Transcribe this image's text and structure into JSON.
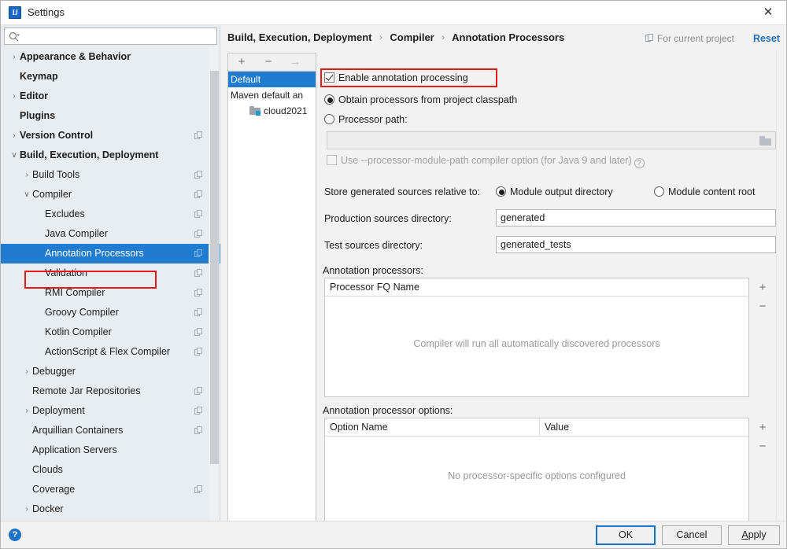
{
  "window": {
    "title": "Settings",
    "app_icon": "intellij-idea-icon",
    "close_icon": "close-icon"
  },
  "search": {
    "icon": "search-icon",
    "value": "",
    "placeholder": ""
  },
  "sidebar": {
    "items": [
      {
        "label": "Appearance & Behavior",
        "indent": 0,
        "arrow": "›",
        "bold": true,
        "config_icon": false,
        "selected": false
      },
      {
        "label": "Keymap",
        "indent": 0,
        "arrow": "",
        "bold": true,
        "config_icon": false,
        "selected": false
      },
      {
        "label": "Editor",
        "indent": 0,
        "arrow": "›",
        "bold": true,
        "config_icon": false,
        "selected": false
      },
      {
        "label": "Plugins",
        "indent": 0,
        "arrow": "",
        "bold": true,
        "config_icon": false,
        "selected": false
      },
      {
        "label": "Version Control",
        "indent": 0,
        "arrow": "›",
        "bold": true,
        "config_icon": true,
        "selected": false
      },
      {
        "label": "Build, Execution, Deployment",
        "indent": 0,
        "arrow": "∨",
        "bold": true,
        "config_icon": false,
        "selected": false
      },
      {
        "label": "Build Tools",
        "indent": 1,
        "arrow": "›",
        "bold": false,
        "config_icon": true,
        "selected": false
      },
      {
        "label": "Compiler",
        "indent": 1,
        "arrow": "∨",
        "bold": false,
        "config_icon": true,
        "selected": false
      },
      {
        "label": "Excludes",
        "indent": 2,
        "arrow": "",
        "bold": false,
        "config_icon": true,
        "selected": false
      },
      {
        "label": "Java Compiler",
        "indent": 2,
        "arrow": "",
        "bold": false,
        "config_icon": true,
        "selected": false
      },
      {
        "label": "Annotation Processors",
        "indent": 2,
        "arrow": "",
        "bold": false,
        "config_icon": true,
        "selected": true
      },
      {
        "label": "Validation",
        "indent": 2,
        "arrow": "",
        "bold": false,
        "config_icon": true,
        "selected": false
      },
      {
        "label": "RMI Compiler",
        "indent": 2,
        "arrow": "",
        "bold": false,
        "config_icon": true,
        "selected": false
      },
      {
        "label": "Groovy Compiler",
        "indent": 2,
        "arrow": "",
        "bold": false,
        "config_icon": true,
        "selected": false
      },
      {
        "label": "Kotlin Compiler",
        "indent": 2,
        "arrow": "",
        "bold": false,
        "config_icon": true,
        "selected": false
      },
      {
        "label": "ActionScript & Flex Compiler",
        "indent": 2,
        "arrow": "",
        "bold": false,
        "config_icon": true,
        "selected": false
      },
      {
        "label": "Debugger",
        "indent": 1,
        "arrow": "›",
        "bold": false,
        "config_icon": false,
        "selected": false
      },
      {
        "label": "Remote Jar Repositories",
        "indent": 1,
        "arrow": "",
        "bold": false,
        "config_icon": true,
        "selected": false
      },
      {
        "label": "Deployment",
        "indent": 1,
        "arrow": "›",
        "bold": false,
        "config_icon": true,
        "selected": false
      },
      {
        "label": "Arquillian Containers",
        "indent": 1,
        "arrow": "",
        "bold": false,
        "config_icon": true,
        "selected": false
      },
      {
        "label": "Application Servers",
        "indent": 1,
        "arrow": "",
        "bold": false,
        "config_icon": false,
        "selected": false
      },
      {
        "label": "Clouds",
        "indent": 1,
        "arrow": "",
        "bold": false,
        "config_icon": false,
        "selected": false
      },
      {
        "label": "Coverage",
        "indent": 1,
        "arrow": "",
        "bold": false,
        "config_icon": true,
        "selected": false
      },
      {
        "label": "Docker",
        "indent": 1,
        "arrow": "›",
        "bold": false,
        "config_icon": false,
        "selected": false
      }
    ]
  },
  "header": {
    "breadcrumb": [
      "Build, Execution, Deployment",
      "Compiler",
      "Annotation Processors"
    ],
    "separator": "›",
    "for_current_project": "For current project",
    "for_current_project_icon": "copy-config-icon",
    "reset_label": "Reset"
  },
  "profiles": {
    "toolbar": {
      "add_label": "+",
      "remove_label": "−",
      "move_label": "→"
    },
    "items": [
      {
        "label": "Default",
        "selected": true,
        "icon": null
      },
      {
        "label": "Maven default an",
        "selected": false,
        "icon": null
      },
      {
        "label": "cloud2021",
        "selected": false,
        "icon": "module-folder-icon"
      }
    ]
  },
  "main": {
    "enable_annotation_processing": {
      "label": "Enable annotation processing",
      "checked": true,
      "highlighted": true
    },
    "processor_source": {
      "option_classpath": "Obtain processors from project classpath",
      "option_path": "Processor path:",
      "selected": "classpath",
      "path_value": "",
      "folder_icon": "folder-browse-icon"
    },
    "module_path_option": {
      "label": "Use --processor-module-path compiler option (for Java 9 and later)",
      "checked": false,
      "disabled": true,
      "help_icon": "?"
    },
    "store_generated": {
      "label": "Store generated sources relative to:",
      "option_output": "Module output directory",
      "option_content": "Module content root",
      "selected": "output"
    },
    "production_sources": {
      "label": "Production sources directory:",
      "value": "generated"
    },
    "test_sources": {
      "label": "Test sources directory:",
      "value": "generated_tests"
    },
    "processors_table": {
      "section_label": "Annotation processors:",
      "columns": [
        "Processor FQ Name"
      ],
      "rows": [],
      "empty_message": "Compiler will run all automatically discovered processors",
      "add_label": "+",
      "remove_label": "−"
    },
    "options_table": {
      "section_label": "Annotation processor options:",
      "columns": [
        "Option Name",
        "Value"
      ],
      "rows": [],
      "empty_message": "No processor-specific options configured",
      "add_label": "+",
      "remove_label": "−"
    }
  },
  "footer": {
    "help_label": "?",
    "ok_label": "OK",
    "cancel_label": "Cancel",
    "apply_label": "Apply"
  },
  "colors": {
    "accent": "#1f7cd0",
    "link": "#2470b8",
    "highlight_box": "#e81b1b",
    "sidebar_bg": "#e8edf1"
  }
}
